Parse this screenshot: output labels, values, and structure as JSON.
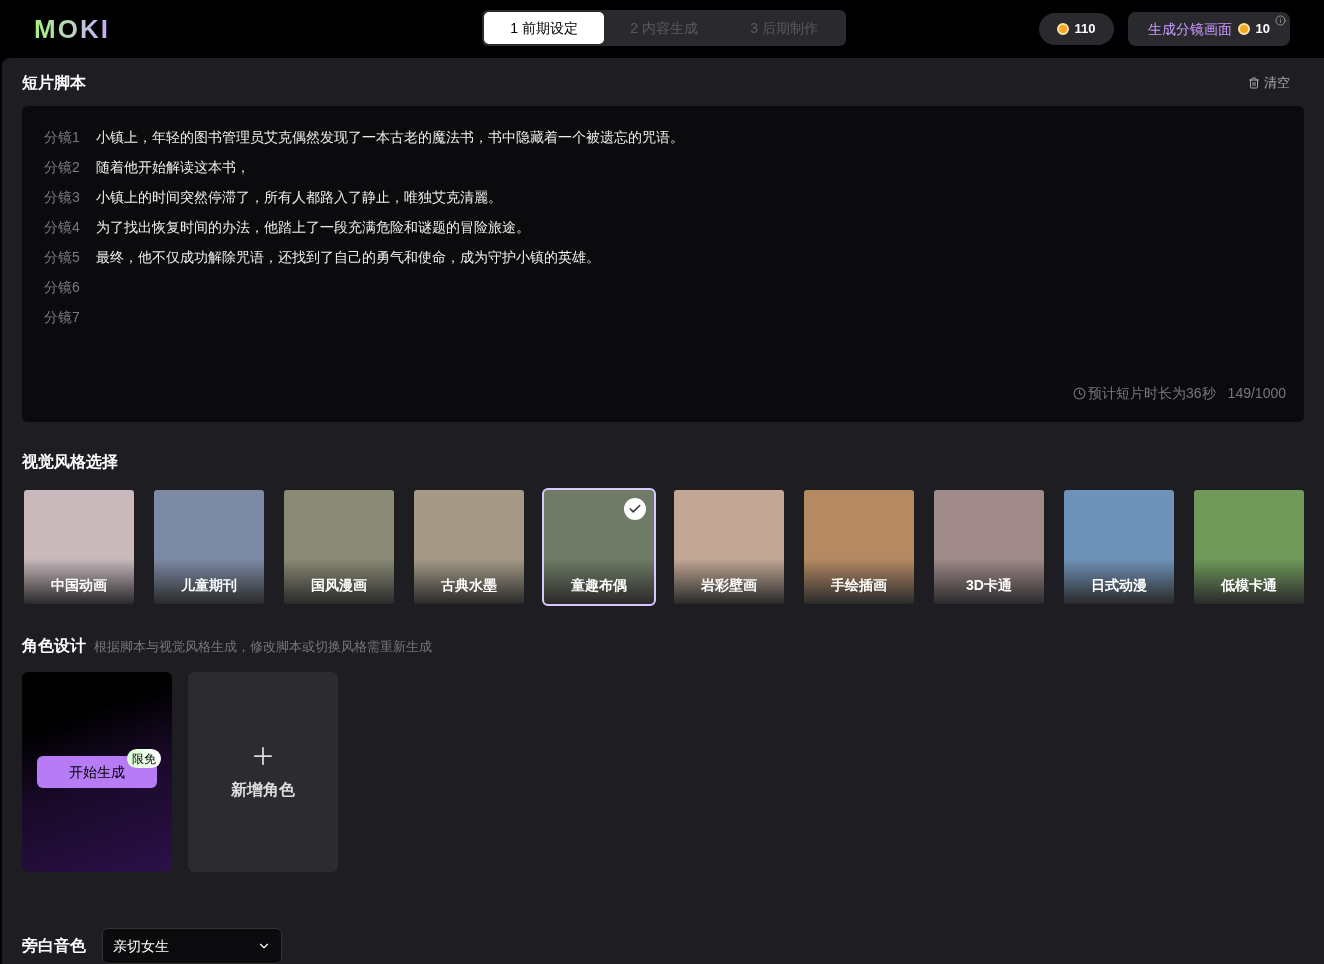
{
  "logo": "MOKI",
  "steps": [
    {
      "label": "1 前期设定",
      "selected": true
    },
    {
      "label": "2 内容生成",
      "selected": false
    },
    {
      "label": "3 后期制作",
      "selected": false
    }
  ],
  "coins": "110",
  "generate_button": {
    "label": "生成分镜画面",
    "cost": "10"
  },
  "script": {
    "title": "短片脚本",
    "clear": "清空",
    "shots": [
      {
        "label": "分镜1",
        "text": "小镇上，年轻的图书管理员艾克偶然发现了一本古老的魔法书，书中隐藏着一个被遗忘的咒语。"
      },
      {
        "label": "分镜2",
        "text": "随着他开始解读这本书，"
      },
      {
        "label": "分镜3",
        "text": "小镇上的时间突然停滞了，所有人都路入了静止，唯独艾克清麗。"
      },
      {
        "label": "分镜4",
        "text": "为了找出恢复时间的办法，他踏上了一段充满危险和谜题的冒险旅途。"
      },
      {
        "label": "分镜5",
        "text": "最终，他不仅成功解除咒语，还找到了自己的勇气和使命，成为守护小镇的英雄。"
      },
      {
        "label": "分镜6"
      },
      {
        "label": "分镜7"
      }
    ],
    "duration": "预计短片时长为36秒",
    "count": "149/1000"
  },
  "styles": {
    "title": "视觉风格选择",
    "items": [
      {
        "name": "中国动画",
        "selected": false,
        "color": "#c9b9bd"
      },
      {
        "name": "儿童期刊",
        "selected": false,
        "color": "#7d8aa6"
      },
      {
        "name": "国风漫画",
        "selected": false,
        "color": "#8a8a76"
      },
      {
        "name": "古典水墨",
        "selected": false,
        "color": "#a59a86"
      },
      {
        "name": "童趣布偶",
        "selected": true,
        "color": "#6f7b66"
      },
      {
        "name": "岩彩壁画",
        "selected": false,
        "color": "#c2a795"
      },
      {
        "name": "手绘插画",
        "selected": false,
        "color": "#b58a63"
      },
      {
        "name": "3D卡通",
        "selected": false,
        "color": "#a08a8a"
      },
      {
        "name": "日式动漫",
        "selected": false,
        "color": "#6e93b8"
      },
      {
        "name": "低模卡通",
        "selected": false,
        "color": "#6f9a5a"
      }
    ]
  },
  "characters": {
    "title": "角色设计",
    "hint": "根据脚本与视觉风格生成，修改脚本或切换风格需重新生成",
    "start_button": "开始生成",
    "free_badge": "限免",
    "add_label": "新增角色"
  },
  "narration": {
    "title": "旁白音色",
    "value": "亲切女生"
  }
}
